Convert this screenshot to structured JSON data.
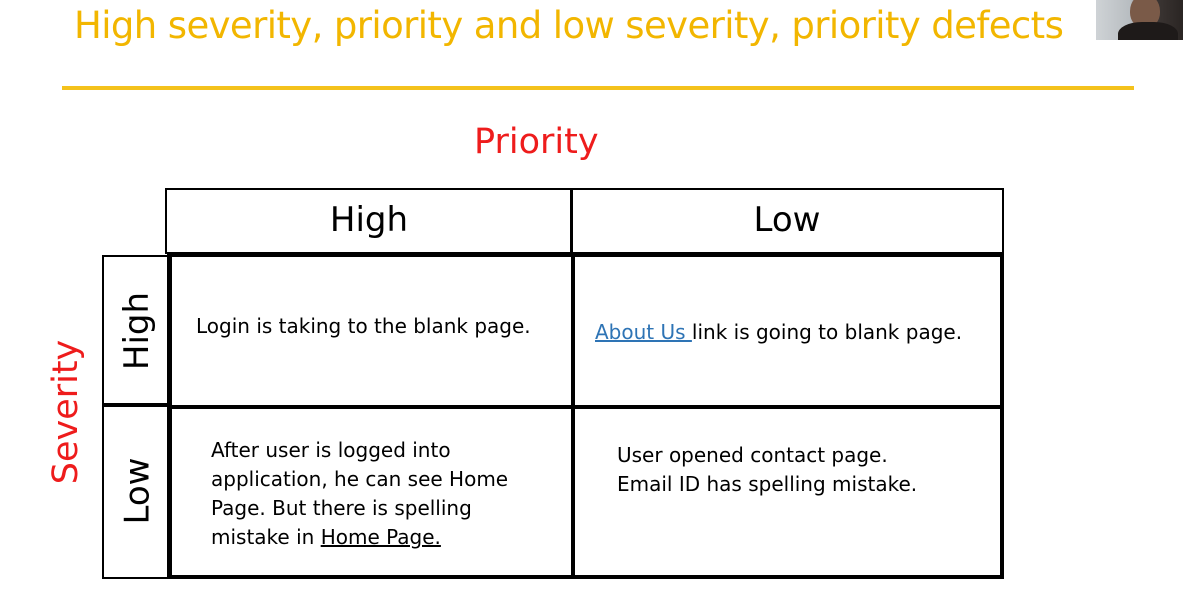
{
  "slide": {
    "title": "High severity, priority and low severity, priority defects"
  },
  "matrix": {
    "priority_title": "Priority",
    "severity_title": "Severity",
    "columns": [
      "High",
      "Low"
    ],
    "rows": [
      "High",
      "Low"
    ],
    "cells": {
      "high_high": "Login is taking to the blank page.",
      "high_low": {
        "link": "About Us ",
        "text": "link  is going to  blank page."
      },
      "low_high": {
        "line1": "After user is logged into",
        "line2": "application, he can see Home",
        "line3": "Page. But there is spelling",
        "line4_prefix": "mistake in ",
        "line4_underlined": "Home Page."
      },
      "low_low": {
        "line1": "User opened contact page.",
        "line2": "Email ID has spelling mistake."
      }
    }
  },
  "colors": {
    "title": "#f2b600",
    "rule": "#f4c21c",
    "axis_titles": "#ee1c1c",
    "link": "#2e74b5"
  }
}
